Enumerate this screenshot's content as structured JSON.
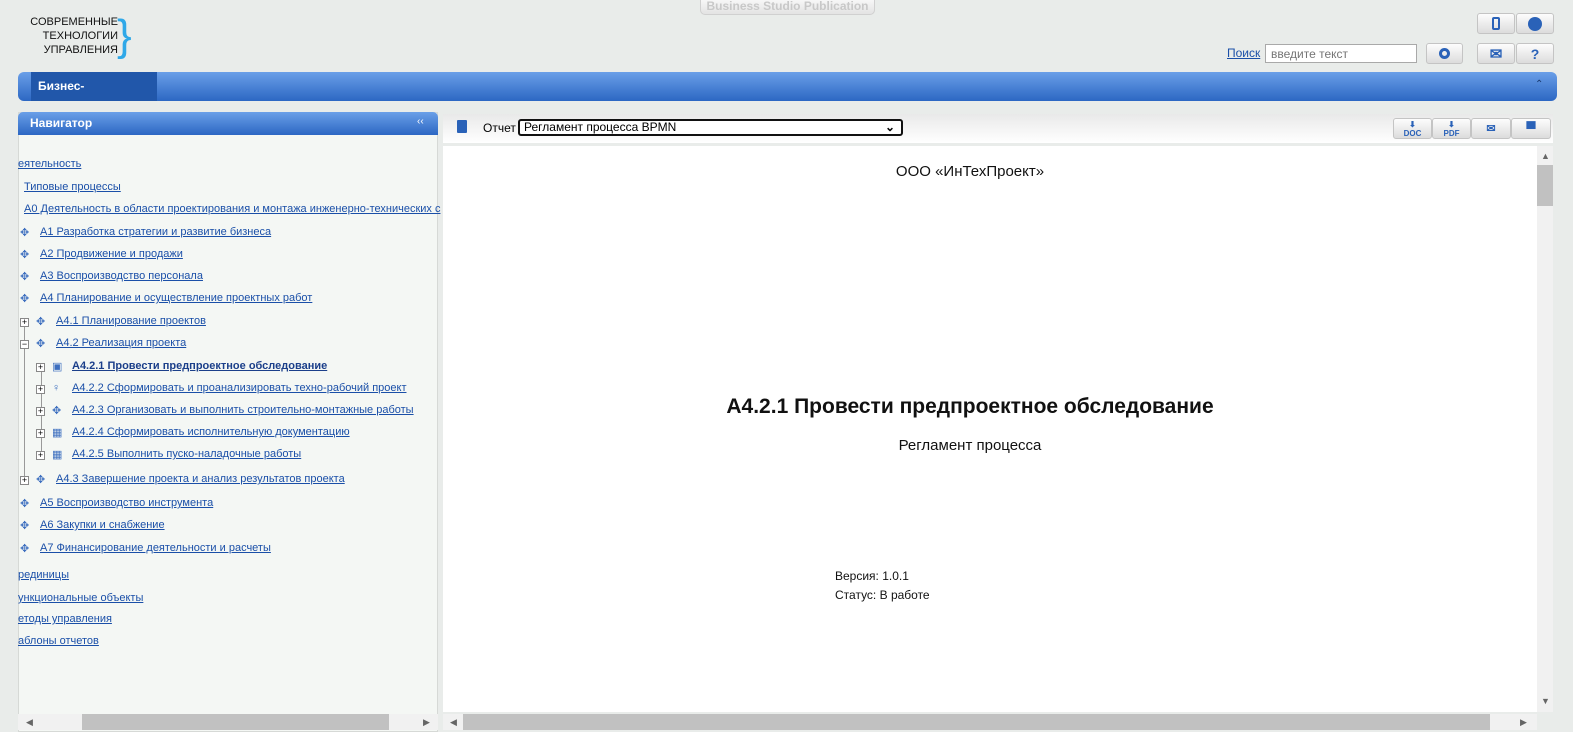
{
  "app": {
    "publication_label": "Business Studio Publication",
    "logo_lines": [
      "СОВРЕМЕННЫЕ",
      "ТЕХНОЛОГИИ",
      "УПРАВЛЕНИЯ"
    ]
  },
  "header": {
    "search_link": "Поиск",
    "search_placeholder": "введите текст",
    "buttons": [
      "mobile-icon",
      "globe-icon",
      "search-icon",
      "mail-icon",
      "help-icon"
    ],
    "help_label": "?"
  },
  "topbar": {
    "tab": "Бизнес-архитектура",
    "accent": "#2c67c3"
  },
  "navigator": {
    "title": "Навигатор",
    "items": [
      {
        "label": "еятельность"
      },
      {
        "label": "Типовые процессы"
      },
      {
        "label": "А0 Деятельность в области проектирования и монтажа инженерно-технических с"
      },
      {
        "label": "А1 Разработка стратегии и развитие бизнеса",
        "icon": "process-icon"
      },
      {
        "label": "А2 Продвижение и продажи",
        "icon": "process-icon"
      },
      {
        "label": "А3 Воспроизводство персонала",
        "icon": "process-icon"
      },
      {
        "label": "А4 Планирование и осуществление проектных работ",
        "icon": "process-icon"
      },
      {
        "label": "А4.1 Планирование проектов",
        "icon": "process-icon",
        "expander": "+"
      },
      {
        "label": "А4.2 Реализация проекта",
        "icon": "process-icon",
        "expander": "−"
      },
      {
        "label": "А4.2.1 Провести предпроектное обследование",
        "icon": "bpmn-diagram-icon",
        "expander": "+",
        "selected": true
      },
      {
        "label": "А4.2.2 Сформировать и проанализировать техно-рабочий проект",
        "icon": "event-icon",
        "expander": "+"
      },
      {
        "label": "А4.2.3 Организовать и выполнить строительно-монтажные работы",
        "icon": "process-icon",
        "expander": "+"
      },
      {
        "label": "А4.2.4 Сформировать исполнительную документацию",
        "icon": "table-icon",
        "expander": "+"
      },
      {
        "label": "А4.2.5 Выполнить пуско-наладочные работы",
        "icon": "table-icon",
        "expander": "+"
      },
      {
        "label": "А4.3 Завершение проекта и анализ результатов проекта",
        "icon": "process-icon",
        "expander": "+"
      },
      {
        "label": "А5 Воспроизводство инструмента",
        "icon": "process-icon"
      },
      {
        "label": "А6 Закупки и снабжение",
        "icon": "process-icon"
      },
      {
        "label": "А7 Финансирование деятельности и расчеты",
        "icon": "process-icon"
      },
      {
        "label": "рединицы"
      },
      {
        "label": "ункциональные объекты"
      },
      {
        "label": "етоды управления"
      },
      {
        "label": "аблоны отчетов"
      }
    ]
  },
  "report": {
    "label": "Отчет",
    "selected": "Регламент процесса BPMN",
    "export_buttons": [
      "DOC",
      "PDF"
    ]
  },
  "document": {
    "company": "ООО «ИнТехПроект»",
    "title": "А4.2.1 Провести предпроектное обследование",
    "subtitle": "Регламент процесса",
    "version": "Версия: 1.0.1",
    "status": "Статус: В работе"
  }
}
